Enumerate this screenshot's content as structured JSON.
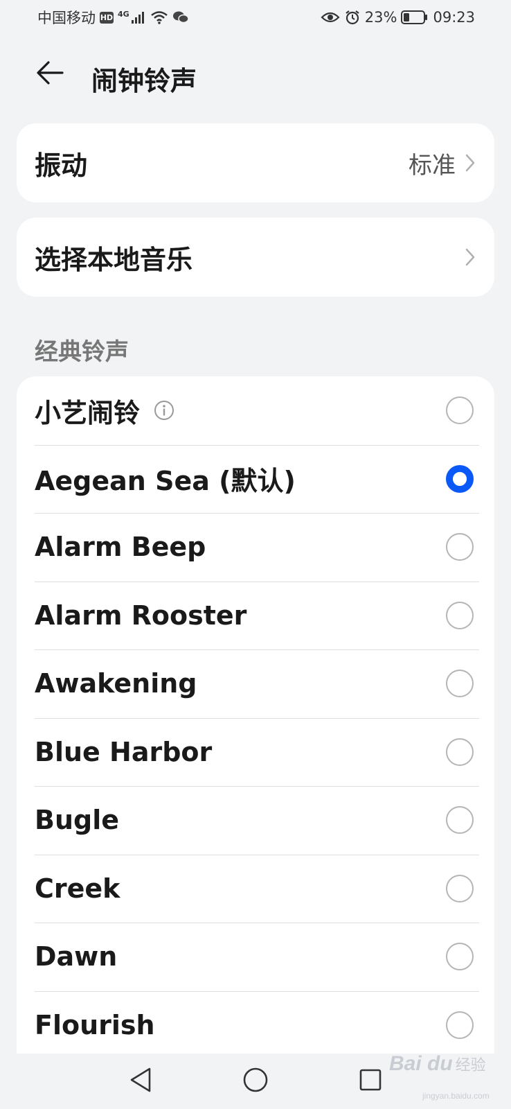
{
  "status_bar": {
    "carrier": "中国移动",
    "hd": "HD",
    "network": "4G",
    "battery": "23%",
    "time": "09:23"
  },
  "header": {
    "back_icon": "arrow-left-icon",
    "title": "闹钟铃声"
  },
  "vibration": {
    "label": "振动",
    "value": "标准"
  },
  "local_music": {
    "label": "选择本地音乐"
  },
  "section": {
    "title": "经典铃声"
  },
  "ringtones": [
    {
      "label": "小艺闹铃",
      "info": true,
      "selected": false
    },
    {
      "label": "Aegean Sea (默认)",
      "selected": true
    },
    {
      "label": "Alarm Beep",
      "selected": false
    },
    {
      "label": "Alarm Rooster",
      "selected": false
    },
    {
      "label": "Awakening",
      "selected": false
    },
    {
      "label": "Blue Harbor",
      "selected": false
    },
    {
      "label": "Bugle",
      "selected": false
    },
    {
      "label": "Creek",
      "selected": false
    },
    {
      "label": "Dawn",
      "selected": false
    },
    {
      "label": "Flourish",
      "selected": false
    }
  ],
  "watermark": {
    "logo": "Bai du",
    "text": "经验",
    "url": "jingyan.baidu.com"
  },
  "colors": {
    "accent": "#0a59f7",
    "background": "#f1f3f5",
    "card": "#ffffff"
  }
}
